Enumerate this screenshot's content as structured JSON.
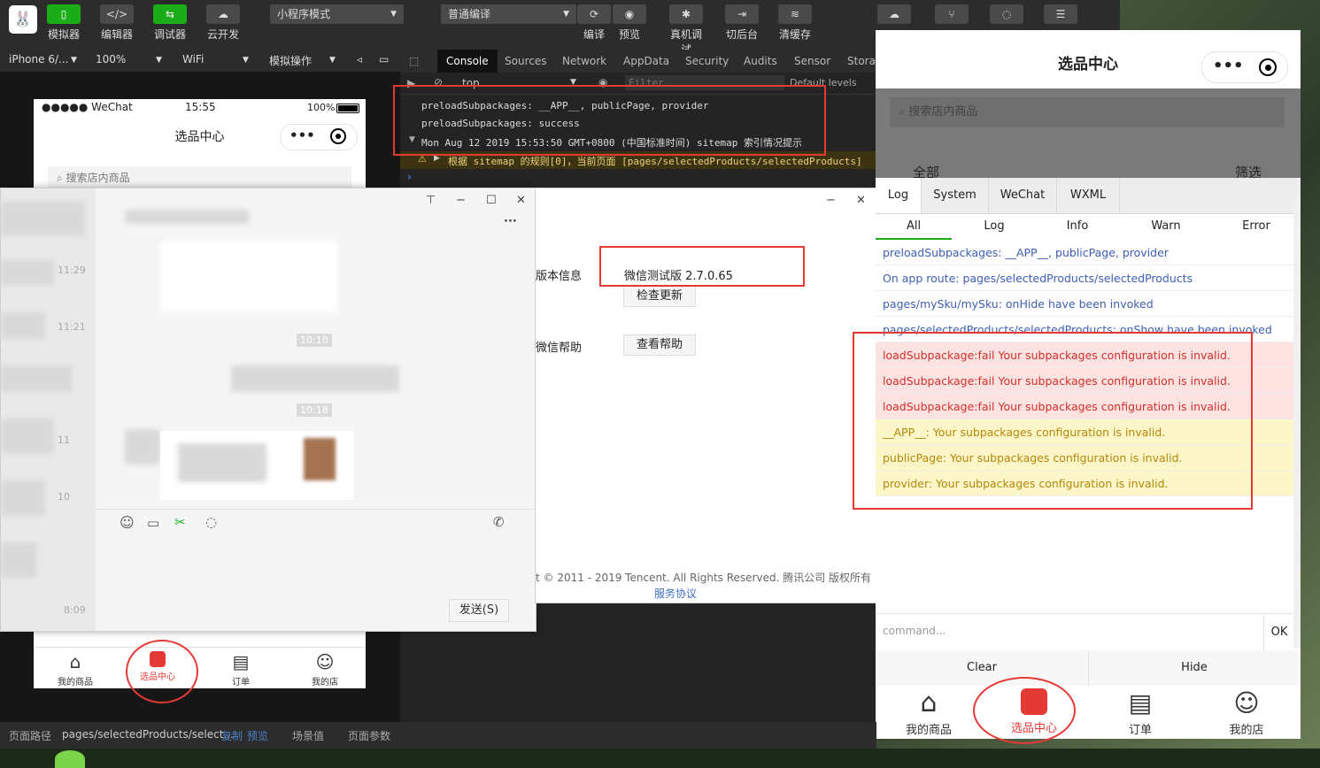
{
  "toolbar": {
    "buttons": [
      {
        "label": "模拟器",
        "icon": "phone-icon"
      },
      {
        "label": "编辑器",
        "icon": "code-icon"
      },
      {
        "label": "调试器",
        "icon": "debug-icon"
      },
      {
        "label": "云开发",
        "icon": "cloud-icon"
      }
    ],
    "mode_select": "小程序模式",
    "compile_select": "普通编译",
    "actions": [
      {
        "label": "编译",
        "icon": "refresh-icon"
      },
      {
        "label": "预览",
        "icon": "eye-icon"
      },
      {
        "label": "真机调试",
        "icon": "bug-icon"
      },
      {
        "label": "切后台",
        "icon": "switch-icon"
      },
      {
        "label": "清缓存",
        "icon": "layers-icon"
      }
    ]
  },
  "device_bar": {
    "device": "iPhone 6/...",
    "zoom": "100%",
    "network": "WiFi",
    "operation": "模拟操作"
  },
  "left_phone": {
    "status_carrier": "●●●●● WeChat",
    "status_time": "15:55",
    "status_battery": "100%",
    "title": "选品中心",
    "search_placeholder": "搜索店内商品"
  },
  "devtools": {
    "tabs": [
      "Console",
      "Sources",
      "Network",
      "AppData",
      "Security",
      "Audits",
      "Sensor",
      "Storag"
    ],
    "context": "top",
    "filter_placeholder": "Filter",
    "levels": "Default levels",
    "lines": [
      "preloadSubpackages: __APP__, publicPage, provider",
      "preloadSubpackages: success",
      "Mon Aug 12 2019 15:53:50 GMT+0800 (中国标准时间) sitemap 索引情况提示",
      "根据 sitemap 的规则[0]，当前页面 [pages/selectedProducts/selectedProducts]"
    ]
  },
  "chat": {
    "times": [
      "11:29",
      "11:21",
      "10:10",
      "11",
      "10:18",
      "8:09",
      "10"
    ],
    "send_button": "发送(S)"
  },
  "about": {
    "version_label": "版本信息",
    "version_value": "微信测试版 2.7.0.65",
    "check_update": "检查更新",
    "help_label": "微信帮助",
    "view_help": "查看帮助",
    "copyright": "t © 2011 - 2019 Tencent. All Rights Reserved. 腾讯公司 版权所有",
    "agreement": "服务协议"
  },
  "right_panel": {
    "title": "选品中心",
    "search_placeholder": "搜索店内商品",
    "filter_all": "全部",
    "filter_screen": "筛选",
    "vconsole_tabs": [
      "Log",
      "System",
      "WeChat",
      "WXML"
    ],
    "vconsole_subtabs": [
      "All",
      "Log",
      "Info",
      "Warn",
      "Error"
    ],
    "logs": [
      {
        "text": "preloadSubpackages: __APP__, publicPage, provider",
        "level": "log"
      },
      {
        "text": "On app route: pages/selectedProducts/selectedProducts",
        "level": "log"
      },
      {
        "text": "pages/mySku/mySku: onHide have been invoked",
        "level": "log"
      },
      {
        "text": "pages/selectedProducts/selectedProducts: onShow have been invoked",
        "level": "log"
      },
      {
        "text": "loadSubpackage:fail Your subpackages configuration is invalid.",
        "level": "error"
      },
      {
        "text": "loadSubpackage:fail Your subpackages configuration is invalid.",
        "level": "error"
      },
      {
        "text": "loadSubpackage:fail Your subpackages configuration is invalid.",
        "level": "error"
      },
      {
        "text": "__APP__: Your subpackages configuration is invalid.",
        "level": "warn"
      },
      {
        "text": "publicPage: Your subpackages configuration is invalid.",
        "level": "warn"
      },
      {
        "text": "provider: Your subpackages configuration is invalid.",
        "level": "warn"
      }
    ],
    "command_placeholder": "command...",
    "ok": "OK",
    "clear": "Clear",
    "hide": "Hide"
  },
  "tabbar": [
    "我的商品",
    "选品中心",
    "订单",
    "我的店"
  ],
  "status_bar": {
    "path_label": "页面路径",
    "path_value": "pages/selectedProducts/select...",
    "copy": "复制",
    "preview": "预览",
    "scene": "场景值",
    "params": "页面参数"
  },
  "colors": {
    "accent_red": "#e53935",
    "wechat_green": "#1aad19",
    "log_blue": "#3c5eb5",
    "error_bg": "#fde2e2",
    "warn_bg": "#fdf6c8"
  }
}
